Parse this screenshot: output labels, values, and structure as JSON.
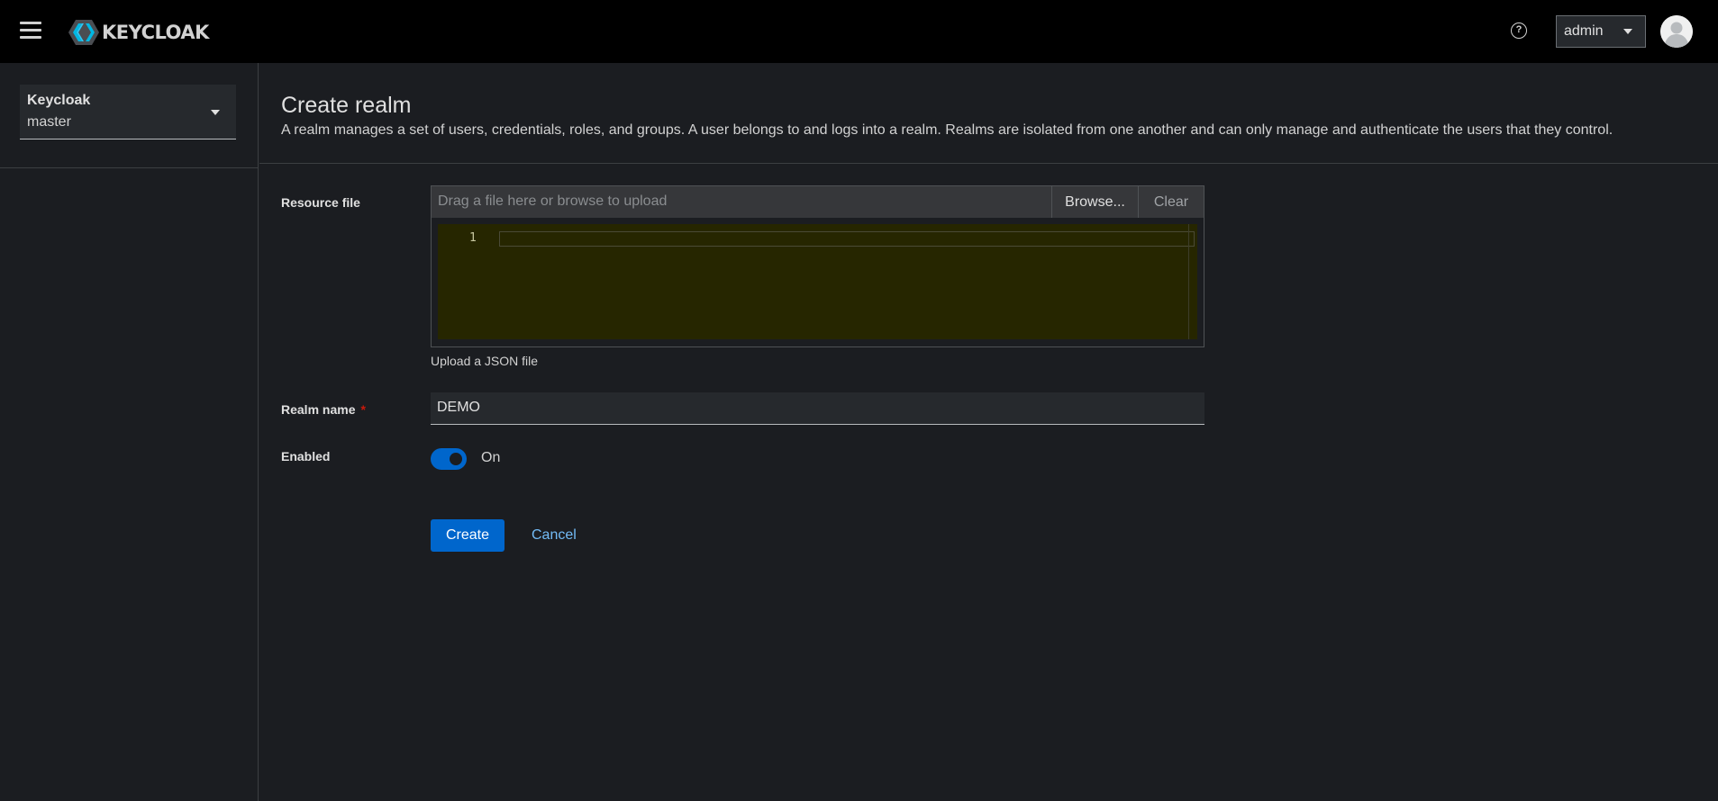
{
  "masthead": {
    "brand_text": "KEYCLOAK",
    "help_icon_glyph": "?",
    "user_menu_label": "admin",
    "icons": [
      "hamburger-menu-icon",
      "keycloak-logo-icon",
      "help-icon",
      "caret-down-icon",
      "user-avatar-icon"
    ]
  },
  "sidebar": {
    "realm_selector": {
      "title": "Keycloak",
      "current_realm": "master"
    }
  },
  "main": {
    "title": "Create realm",
    "description": "A realm manages a set of users, credentials, roles, and groups. A user belongs to and logs into a realm. Realms are isolated from one another and can only manage and authenticate the users that they control.",
    "resource_file": {
      "label": "Resource file",
      "placeholder": "Drag a file here or browse to upload",
      "browse_label": "Browse...",
      "clear_label": "Clear",
      "line_number": "1",
      "helper_text": "Upload a JSON file"
    },
    "realm_name": {
      "label": "Realm name",
      "required_mark": "*",
      "value": "DEMO"
    },
    "enabled": {
      "label": "Enabled",
      "state_label": "On",
      "checked": true
    },
    "actions": {
      "create_label": "Create",
      "cancel_label": "Cancel"
    }
  },
  "colors": {
    "masthead_bg": "#000000",
    "page_bg": "#1b1d21",
    "primary": "#0066cc",
    "link": "#73bcf7",
    "required": "#c9190b",
    "editor_bg": "#262600"
  }
}
